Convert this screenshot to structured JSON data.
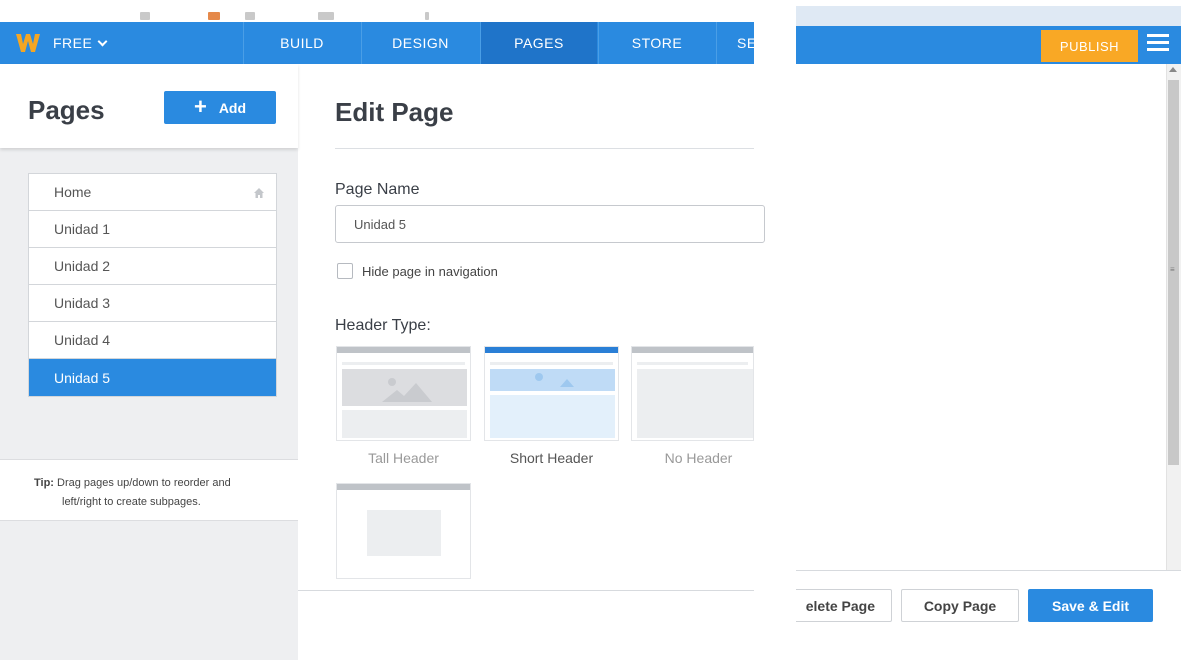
{
  "nav": {
    "plan_label": "FREE",
    "tabs": [
      {
        "label": "BUILD",
        "active": false
      },
      {
        "label": "DESIGN",
        "active": false
      },
      {
        "label": "PAGES",
        "active": true
      },
      {
        "label": "STORE",
        "active": false
      },
      {
        "label": "SE",
        "active": false
      }
    ],
    "publish_label": "PUBLISH"
  },
  "sidebar": {
    "title": "Pages",
    "add_label": "Add",
    "pages": [
      {
        "label": "Home",
        "is_home": true,
        "active": false
      },
      {
        "label": "Unidad 1",
        "is_home": false,
        "active": false
      },
      {
        "label": "Unidad 2",
        "is_home": false,
        "active": false
      },
      {
        "label": "Unidad 3",
        "is_home": false,
        "active": false
      },
      {
        "label": "Unidad 4",
        "is_home": false,
        "active": false
      },
      {
        "label": "Unidad 5",
        "is_home": false,
        "active": true
      }
    ],
    "tip_label": "Tip:",
    "tip_line1": "Drag pages up/down to reorder and",
    "tip_line2": "left/right to create subpages."
  },
  "edit": {
    "title": "Edit Page",
    "page_name_label": "Page Name",
    "page_name_value": "Unidad 5",
    "hide_label": "Hide page in navigation",
    "hide_checked": false,
    "header_type_label": "Header Type:",
    "header_options": [
      {
        "label": "Tall Header",
        "selected": false
      },
      {
        "label": "Short Header",
        "selected": true
      },
      {
        "label": "No Header",
        "selected": false
      }
    ]
  },
  "footer": {
    "delete_label": "elete Page",
    "copy_label": "Copy Page",
    "save_label": "Save & Edit"
  },
  "colors": {
    "nav_blue": "#2a8ae0",
    "publish_orange": "#f9a825",
    "logo_orange": "#f5a623"
  }
}
